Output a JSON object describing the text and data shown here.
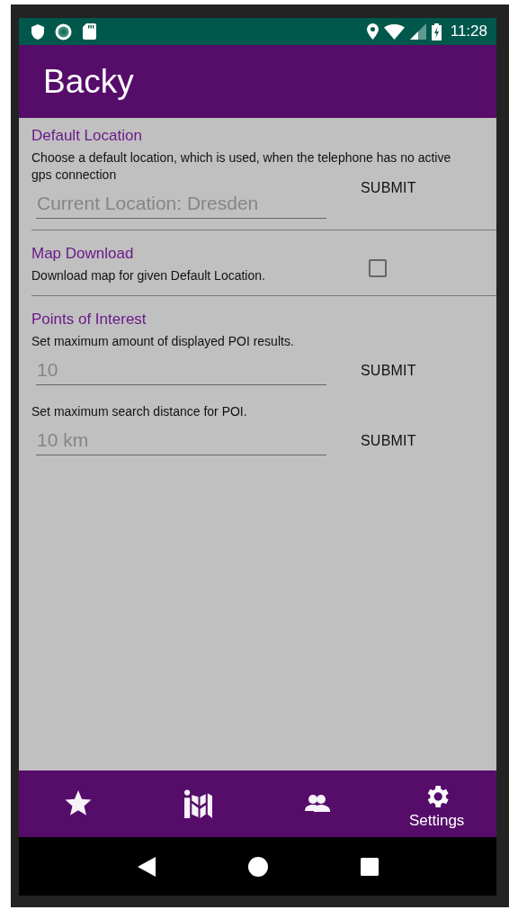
{
  "status_bar": {
    "time": "11:28"
  },
  "app_bar": {
    "title": "Backy"
  },
  "sections": [
    {
      "kind": "location",
      "title": "Default Location",
      "description": "Choose a default location, which is used, when the telephone has no active gps connection",
      "field": {
        "placeholder": "Current Location: Dresden"
      },
      "button": "SUBMIT"
    },
    {
      "kind": "toggle",
      "title": "Map Download",
      "description": "Download map for given Default Location.",
      "checked": false
    },
    {
      "kind": "poi",
      "title": "Points of Interest",
      "settings": [
        {
          "description": "Set maximum amount of displayed POI results.",
          "field": {
            "placeholder": "10"
          },
          "button": "SUBMIT"
        },
        {
          "description": "Set maximum search distance for POI.",
          "field": {
            "placeholder": "10 km"
          },
          "button": "SUBMIT"
        }
      ]
    }
  ],
  "bottom_nav": [
    {
      "kind": "star",
      "selected": false
    },
    {
      "kind": "map",
      "selected": false
    },
    {
      "kind": "people",
      "selected": false
    },
    {
      "kind": "gear",
      "label": "Settings",
      "selected": true
    }
  ]
}
